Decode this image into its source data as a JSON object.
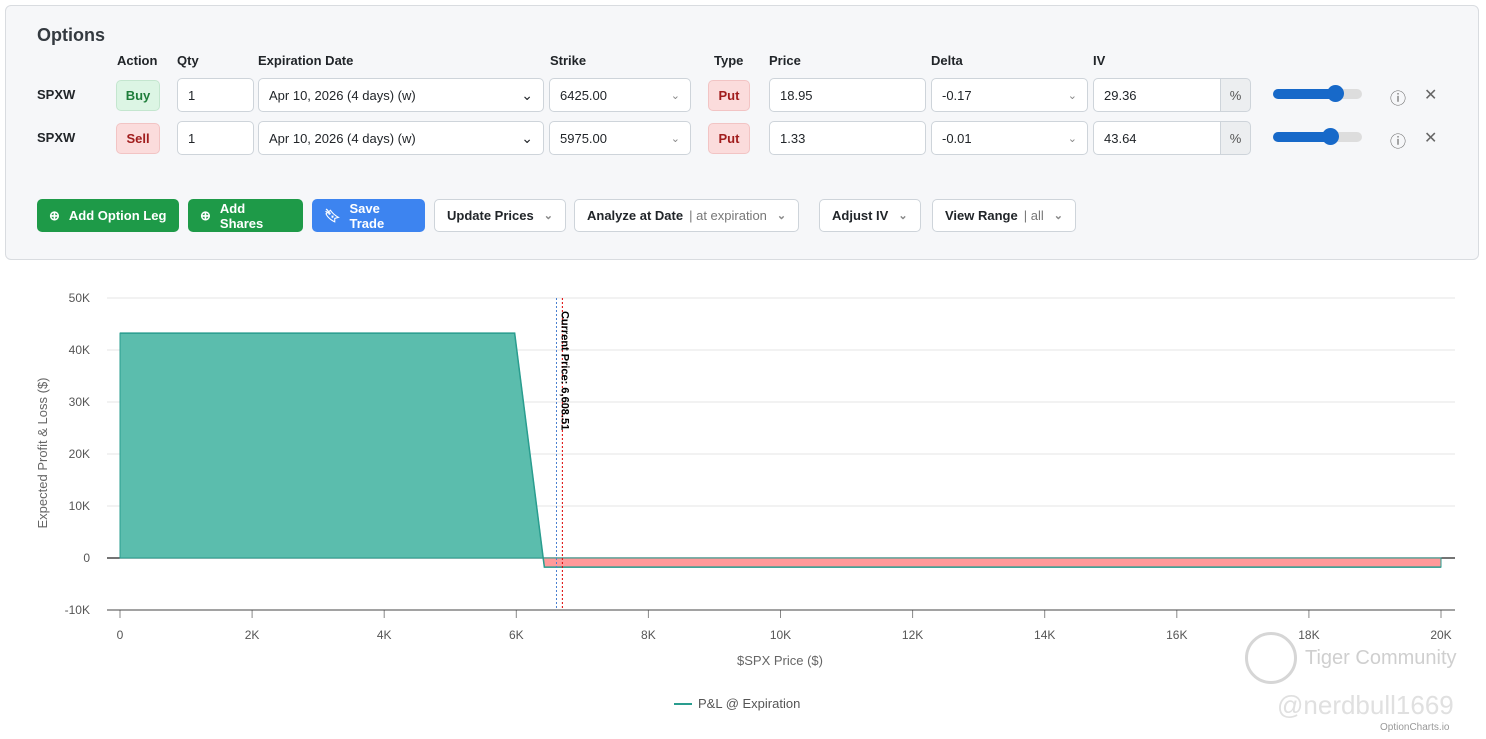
{
  "panel": {
    "title": "Options",
    "headers": {
      "action": "Action",
      "qty": "Qty",
      "expiration": "Expiration Date",
      "strike": "Strike",
      "type": "Type",
      "price": "Price",
      "delta": "Delta",
      "iv": "IV"
    },
    "legs": [
      {
        "symbol": "SPXW",
        "action": "Buy",
        "qty": "1",
        "expiration": "Apr 10, 2026 (4 days) (w)",
        "strike": "6425.00",
        "type": "Put",
        "price": "18.95",
        "delta": "-0.17",
        "iv": "29.36",
        "iv_unit": "%",
        "slider_fraction": 0.7
      },
      {
        "symbol": "SPXW",
        "action": "Sell",
        "qty": "1",
        "expiration": "Apr 10, 2026 (4 days) (w)",
        "strike": "5975.00",
        "type": "Put",
        "price": "1.33",
        "delta": "-0.01",
        "iv": "43.64",
        "iv_unit": "%",
        "slider_fraction": 0.65
      }
    ],
    "buttons": {
      "add_leg": "Add Option Leg",
      "add_shares": "Add Shares",
      "save": "Save Trade",
      "update_prices": "Update Prices",
      "analyze": "Analyze at Date",
      "analyze_sub": "| at expiration",
      "adjust_iv": "Adjust IV",
      "view_range": "View Range",
      "view_range_sub": "| all"
    }
  },
  "chart_data": {
    "type": "area",
    "xlabel": "$SPX Price ($)",
    "ylabel": "Expected Profit & Loss ($)",
    "xlim": [
      0,
      20000
    ],
    "ylim": [
      -10000,
      50000
    ],
    "xticks": [
      "0",
      "2K",
      "4K",
      "6K",
      "8K",
      "10K",
      "12K",
      "14K",
      "16K",
      "18K",
      "20K"
    ],
    "yticks": [
      "50K",
      "40K",
      "30K",
      "20K",
      "10K",
      "0",
      "-10K"
    ],
    "series": [
      {
        "name": "P&L @ Expiration",
        "x": [
          0,
          5975,
          6407,
          6425,
          20000
        ],
        "y": [
          43238,
          43238,
          0,
          -1762,
          -1762
        ]
      }
    ],
    "annotations": {
      "current_price_label": "Current Price: 6,608.51",
      "current_price": 6608.51,
      "strike_line": 6425
    },
    "legend": "bottom",
    "colors": {
      "profit": "#5bbdad",
      "loss": "#ff9a9a",
      "line": "#2a9d8f"
    }
  },
  "watermark": {
    "brand": "Tiger Community",
    "user": "@nerdbull1669",
    "site": "OptionCharts.io"
  }
}
